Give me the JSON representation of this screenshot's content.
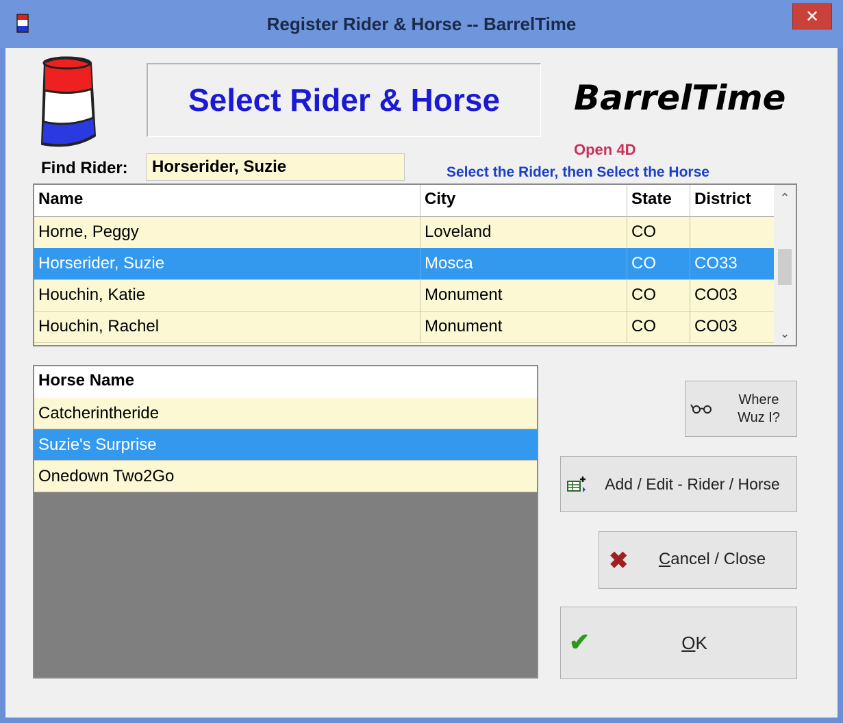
{
  "window": {
    "title": "Register Rider & Horse -- BarrelTime",
    "close_glyph": "✕"
  },
  "header": {
    "title": "Select Rider & Horse",
    "brand": "BarrelTime",
    "subtitle": "Open 4D",
    "instruction": "Select the Rider, then Select the Horse"
  },
  "find": {
    "label": "Find Rider:",
    "value": "Horserider, Suzie"
  },
  "riders": {
    "columns": [
      "Name",
      "City",
      "State",
      "District"
    ],
    "rows": [
      {
        "name": "Horne, Peggy",
        "city": "Loveland",
        "state": "CO",
        "district": "",
        "selected": false
      },
      {
        "name": "Horserider, Suzie",
        "city": "Mosca",
        "state": "CO",
        "district": "CO33",
        "selected": true
      },
      {
        "name": "Houchin, Katie",
        "city": "Monument",
        "state": "CO",
        "district": "CO03",
        "selected": false
      },
      {
        "name": "Houchin, Rachel",
        "city": "Monument",
        "state": "CO",
        "district": "CO03",
        "selected": false
      }
    ]
  },
  "horses": {
    "column": "Horse Name",
    "rows": [
      {
        "name": "Catcherintheride",
        "selected": false
      },
      {
        "name": "Suzie's Surprise",
        "selected": true
      },
      {
        "name": "Onedown Two2Go",
        "selected": false
      }
    ]
  },
  "buttons": {
    "where_line1": "Where",
    "where_line2": "Wuz I?",
    "add_edit": "Add / Edit - Rider / Horse",
    "cancel_first": "C",
    "cancel_rest": "ancel / Close",
    "ok_first": "O",
    "ok_rest": "K"
  },
  "icons": {
    "where": "glasses-icon",
    "add": "grid-add-icon",
    "cancel": "red-x-icon",
    "ok": "green-check-icon"
  },
  "colors": {
    "selection": "#3399ef",
    "row_background": "#fcf8d4",
    "title_blue": "#1a1ad4",
    "subtitle_red": "#c8325a",
    "instruction_blue": "#1a3fc8"
  }
}
